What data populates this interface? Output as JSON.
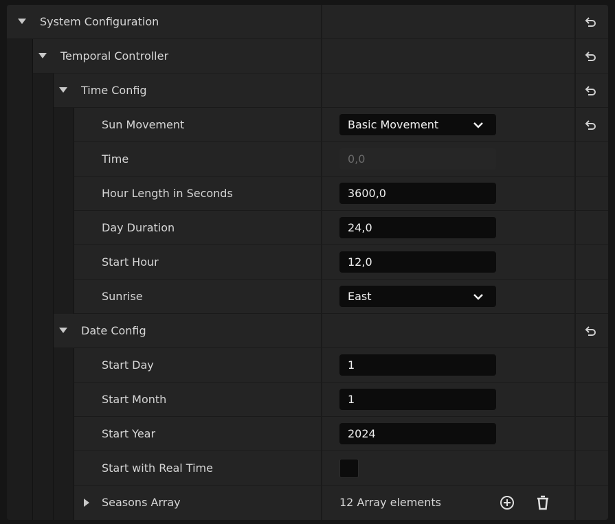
{
  "rows": {
    "system_config": {
      "label": "System Configuration"
    },
    "temporal_controller": {
      "label": "Temporal Controller"
    },
    "time_config": {
      "label": "Time Config"
    },
    "sun_movement": {
      "label": "Sun Movement",
      "value": "Basic Movement"
    },
    "time": {
      "label": "Time",
      "value": "0,0"
    },
    "hour_length": {
      "label": "Hour Length in Seconds",
      "value": "3600,0"
    },
    "day_duration": {
      "label": "Day Duration",
      "value": "24,0"
    },
    "start_hour": {
      "label": "Start Hour",
      "value": "12,0"
    },
    "sunrise": {
      "label": "Sunrise",
      "value": "East"
    },
    "date_config": {
      "label": "Date Config"
    },
    "start_day": {
      "label": "Start Day",
      "value": "1"
    },
    "start_month": {
      "label": "Start Month",
      "value": "1"
    },
    "start_year": {
      "label": "Start Year",
      "value": "2024"
    },
    "start_real_time": {
      "label": "Start with Real Time",
      "checked": false
    },
    "seasons_array": {
      "label": "Seasons Array",
      "value": "12 Array elements"
    }
  },
  "icons": {
    "reset": "reset-to-default-icon",
    "expand": "expand-arrow-icon",
    "collapse": "collapse-arrow-icon",
    "dropdown": "chevron-down-icon",
    "add": "add-circle-icon",
    "delete": "trash-icon"
  },
  "colors": {
    "panel": "#242424",
    "field": "#0c0c0c",
    "text": "#d6d6d6"
  }
}
